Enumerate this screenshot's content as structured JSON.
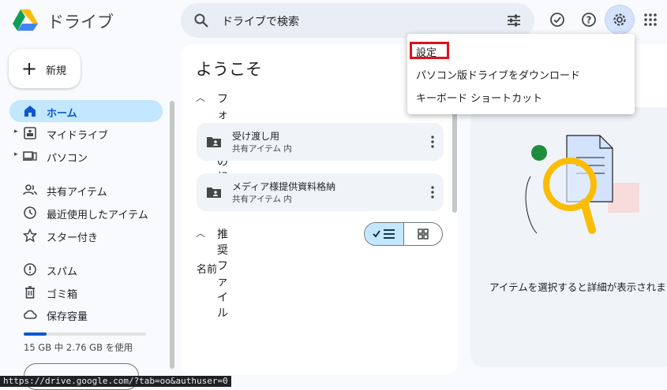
{
  "app": {
    "title": "ドライブ"
  },
  "search": {
    "placeholder": "ドライブで検索"
  },
  "new_button": {
    "label": "新規"
  },
  "sidebar": {
    "items": [
      {
        "label": "ホーム"
      },
      {
        "label": "マイドライブ"
      },
      {
        "label": "パソコン"
      },
      {
        "label": "共有アイテム"
      },
      {
        "label": "最近使用したアイテム"
      },
      {
        "label": "スター付き"
      },
      {
        "label": "スパム"
      },
      {
        "label": "ゴミ箱"
      },
      {
        "label": "保存容量"
      }
    ],
    "quota": {
      "text": "15 GB 中 2.76 GB を使用",
      "used_fraction": 0.184
    }
  },
  "main": {
    "welcome": "ようこそ",
    "folder_section": "フォルダの候補",
    "folders": [
      {
        "name": "受け渡し用",
        "sub": "共有アイテム 内"
      },
      {
        "name": "メディア様提供資料格納",
        "sub": "共有アイテム 内"
      }
    ],
    "files_section": "推奨ファイル",
    "name_header": "名前"
  },
  "details": {
    "text": "アイテムを選択すると詳細が表示されま"
  },
  "settings_menu": {
    "items": [
      {
        "label": "設定"
      },
      {
        "label": "パソコン版ドライブをダウンロード"
      },
      {
        "label": "キーボード ショートカット"
      }
    ]
  },
  "status_bar": {
    "url": "https://drive.google.com/?tab=oo&authuser=0"
  },
  "colors": {
    "accent": "#0b57d0",
    "selected_bg": "#c2e7ff",
    "highlight_box": "#e0111b"
  }
}
